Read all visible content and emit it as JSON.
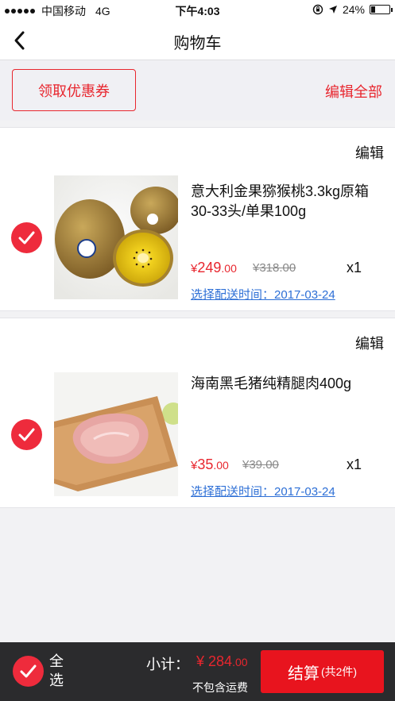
{
  "status_bar": {
    "carrier": "中国移动",
    "network": "4G",
    "time": "下午4:03",
    "battery": "24%"
  },
  "nav": {
    "title": "购物车",
    "back_icon": "chevron-left-icon"
  },
  "coupon_bar": {
    "coupon_label": "领取优惠券",
    "edit_all_label": "编辑全部"
  },
  "items": [
    {
      "edit_label": "编辑",
      "name": "意大利金果猕猴桃3.3kg原箱30-33头/单果100g",
      "price_int": "249",
      "price_dec": ".00",
      "currency": "¥",
      "old_price": "¥318.00",
      "quantity": "x1",
      "delivery": "选择配送时间：2017-03-24",
      "checked": true,
      "image_icon": "kiwi-fruit-image"
    },
    {
      "edit_label": "编辑",
      "name": "海南黑毛猪纯精腿肉400g",
      "price_int": "35",
      "price_dec": ".00",
      "currency": "¥",
      "old_price": "¥39.00",
      "quantity": "x1",
      "delivery": "选择配送时间：2017-03-24",
      "checked": true,
      "image_icon": "pork-leg-image"
    }
  ],
  "footer": {
    "select_all_label": "全选",
    "subtotal_label": "小计：",
    "subtotal_currency": "¥",
    "subtotal_int": "284",
    "subtotal_dec": ".00",
    "shipping_note": "不包含运费",
    "checkout_label": "结算",
    "checkout_count": "(共2件)"
  },
  "colors": {
    "accent": "#e8262e",
    "check": "#ee2b3c",
    "link": "#2d6fd6",
    "footer_bg": "#2b2b2d"
  }
}
